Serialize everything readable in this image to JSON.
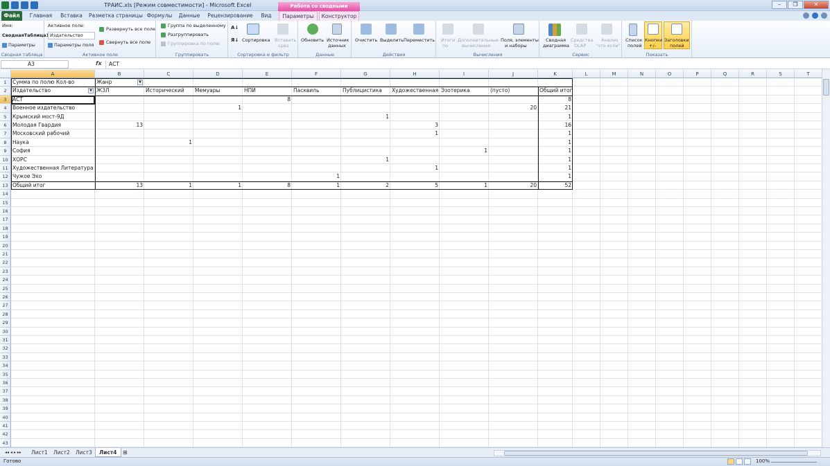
{
  "window": {
    "title": "ТРАИС.xls  [Режим совместимости]  -  Microsoft Excel",
    "context_label": "Работа со сводными таблицами"
  },
  "ribbon_tabs": [
    "Файл",
    "Главная",
    "Вставка",
    "Разметка страницы",
    "Формулы",
    "Данные",
    "Рецензирование",
    "Вид",
    "Параметры",
    "Конструктор"
  ],
  "ribbon": {
    "pivot_table": {
      "name_label": "Имя:",
      "name_value": "СводнаяТаблица1",
      "options": "Параметры",
      "group": "Сводная таблица"
    },
    "active_field": {
      "label": "Активное поле:",
      "value": "Издательство",
      "field_params": "Параметры поля",
      "expand": "Развернуть все поле",
      "collapse": "Свернуть все поле",
      "group": "Активное поле"
    },
    "grouping": {
      "by_selection": "Группа по выделенному",
      "ungroup": "Разгруппировать",
      "field": "Группировка по полю",
      "group": "Группировать"
    },
    "sort": {
      "sort": "Сортировка",
      "insert_slicer_1": "Вставить",
      "insert_slicer_2": "срез",
      "group": "Сортировка и фильтр"
    },
    "data": {
      "refresh": "Обновить",
      "source_1": "Источник",
      "source_2": "данных",
      "group": "Данные"
    },
    "actions": {
      "clear": "Очистить",
      "select": "Выделить",
      "move": "Переместить",
      "group": "Действия"
    },
    "calc": {
      "totals_1": "Итоги",
      "totals_2": "по",
      "extra_1": "Дополнительные",
      "extra_2": "вычисления",
      "fields_1": "Поля, элементы",
      "fields_2": "и наборы",
      "group": "Вычисления"
    },
    "tools": {
      "chart_1": "Сводная",
      "chart_2": "диаграмма",
      "olap_1": "Средства",
      "olap_2": "OLAP",
      "whatif_1": "Анализ",
      "whatif_2": "\"что если\"",
      "group": "Сервис"
    },
    "show": {
      "field_list_1": "Список",
      "field_list_2": "полей",
      "buttons_1": "Кнопки",
      "buttons_2": "+/-",
      "headers_1": "Заголовки",
      "headers_2": "полей",
      "group": "Показать"
    }
  },
  "formula_bar": {
    "name_box": "A3",
    "fx": "fx",
    "content": "АСТ"
  },
  "columns": [
    "A",
    "B",
    "C",
    "D",
    "E",
    "F",
    "G",
    "H",
    "I",
    "J",
    "K",
    "L",
    "M",
    "N",
    "O",
    "P",
    "Q",
    "R",
    "S",
    "T"
  ],
  "pivot": {
    "header_label": "Сумма по полю Кол-во",
    "col_field": "Жанр",
    "row_field": "Издательство",
    "genres": [
      "ЖЗЛ",
      "Исторический",
      "Мемуары",
      "НПИ",
      "Пасквиль",
      "Публицистика",
      "Художественная",
      "Эзотерика",
      "(пусто)"
    ],
    "total_label": "Общий итог",
    "rows": [
      {
        "name": "АСТ",
        "values": [
          "",
          "",
          "",
          "8",
          "",
          "",
          "",
          "",
          ""
        ],
        "total": "8"
      },
      {
        "name": "Военное издательство",
        "values": [
          "",
          "",
          "1",
          "",
          "",
          "",
          "",
          "",
          "20"
        ],
        "total": "21"
      },
      {
        "name": "Крымский мост-9Д",
        "values": [
          "",
          "",
          "",
          "",
          "",
          "1",
          "",
          "",
          ""
        ],
        "total": "1"
      },
      {
        "name": "Молодая Гвардия",
        "values": [
          "13",
          "",
          "",
          "",
          "",
          "",
          "3",
          "",
          ""
        ],
        "total": "16"
      },
      {
        "name": "Московский рабочий",
        "values": [
          "",
          "",
          "",
          "",
          "",
          "",
          "1",
          "",
          ""
        ],
        "total": "1"
      },
      {
        "name": "Наука",
        "values": [
          "",
          "1",
          "",
          "",
          "",
          "",
          "",
          "",
          ""
        ],
        "total": "1"
      },
      {
        "name": "София",
        "values": [
          "",
          "",
          "",
          "",
          "",
          "",
          "",
          "1",
          ""
        ],
        "total": "1"
      },
      {
        "name": "ХОРС",
        "values": [
          "",
          "",
          "",
          "",
          "",
          "1",
          "",
          "",
          ""
        ],
        "total": "1"
      },
      {
        "name": "Художественная Литература",
        "values": [
          "",
          "",
          "",
          "",
          "",
          "",
          "1",
          "",
          ""
        ],
        "total": "1"
      },
      {
        "name": "Чужое Эхо",
        "values": [
          "",
          "",
          "",
          "",
          "1",
          "",
          "",
          "",
          ""
        ],
        "total": "1"
      }
    ],
    "grand_total": {
      "name": "Общий итог",
      "values": [
        "13",
        "1",
        "1",
        "8",
        "1",
        "2",
        "5",
        "1",
        "20"
      ],
      "total": "52"
    }
  },
  "sheets": [
    "Лист1",
    "Лист2",
    "Лист3",
    "Лист4"
  ],
  "active_sheet": "Лист4",
  "status": {
    "ready": "Готово",
    "zoom": "100%"
  }
}
